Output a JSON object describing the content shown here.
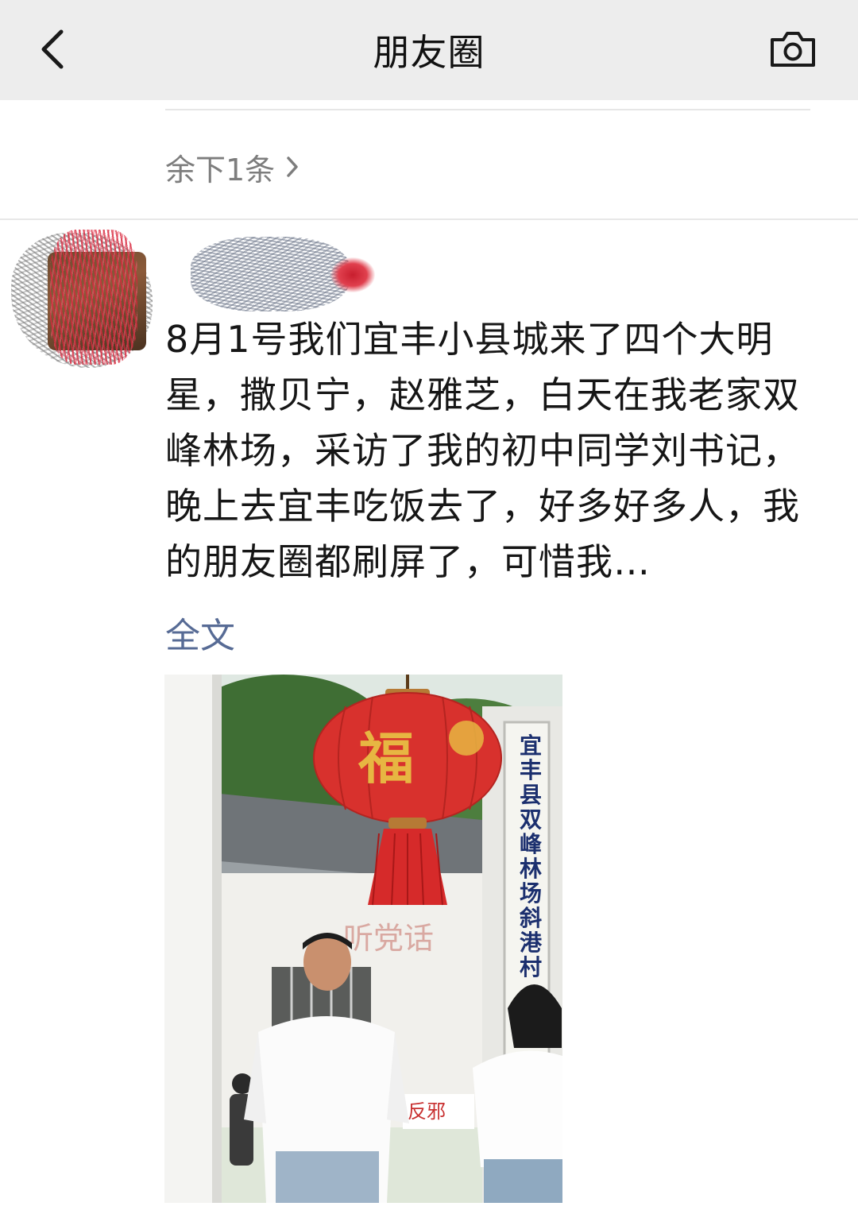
{
  "nav": {
    "title": "朋友圈",
    "back_icon": "chevron-left-icon",
    "camera_icon": "camera-icon"
  },
  "collapsed": {
    "label": "余下1条",
    "icon": "chevron-right-icon"
  },
  "post": {
    "text": "8月1号我们宜丰小县城来了四个大明星，撒贝宁，赵雅芝，白天在我老家双峰林场，采访了我的初中同学刘书记，晚上去宜丰吃饭去了，好多好多人，我的朋友圈都刷屏了，可惜我…",
    "expand_label": "全文",
    "photo": {
      "lantern_character": "福",
      "sign_text": "宜丰县双峰林场斜港村",
      "wall_slogan": "听党话",
      "banner_text": "反邪"
    }
  },
  "colors": {
    "nav_bg": "#ededed",
    "link": "#576b95",
    "secondary_text": "#7d7d7d"
  }
}
